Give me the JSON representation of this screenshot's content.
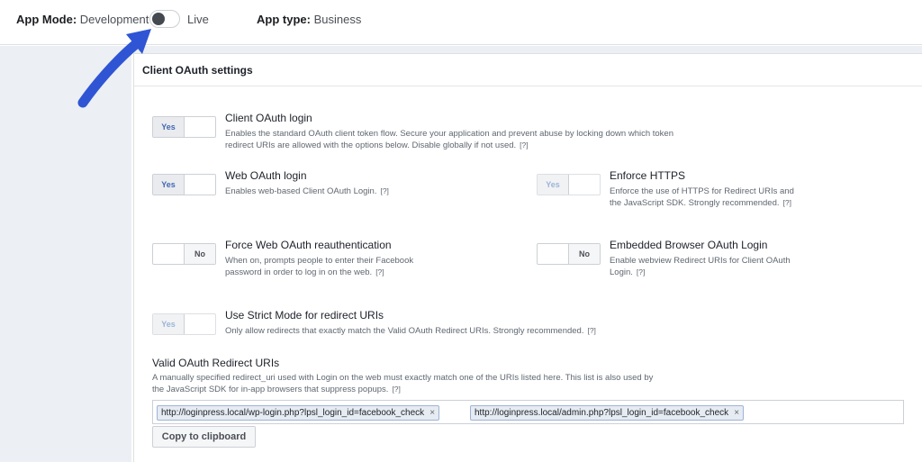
{
  "topbar": {
    "app_mode_label": "App Mode:",
    "app_mode_value": "Development",
    "live_label": "Live",
    "app_type_label": "App type:",
    "app_type_value": "Business"
  },
  "section": {
    "title": "Client OAuth settings"
  },
  "options": [
    {
      "title": "Client OAuth login",
      "desc": "Enables the standard OAuth client token flow. Secure your application and prevent abuse by locking down which token redirect URIs are allowed with the options below. Disable globally if not used.",
      "help": "[?]",
      "state": "Yes"
    },
    {
      "title": "Web OAuth login",
      "desc": "Enables web-based Client OAuth Login.",
      "help": "[?]",
      "state": "Yes"
    },
    {
      "title": "Enforce HTTPS",
      "desc": "Enforce the use of HTTPS for Redirect URIs and the JavaScript SDK. Strongly recommended.",
      "help": "[?]",
      "state": "Yes"
    },
    {
      "title": "Force Web OAuth reauthentication",
      "desc": "When on, prompts people to enter their Facebook password in order to log in on the web.",
      "help": "[?]",
      "state": "No"
    },
    {
      "title": "Embedded Browser OAuth Login",
      "desc": "Enable webview Redirect URIs for Client OAuth Login.",
      "help": "[?]",
      "state": "No"
    },
    {
      "title": "Use Strict Mode for redirect URIs",
      "desc": "Only allow redirects that exactly match the Valid OAuth Redirect URIs. Strongly recommended.",
      "help": "[?]",
      "state": "Yes"
    }
  ],
  "switch_labels": {
    "yes": "Yes",
    "no": "No"
  },
  "redirect": {
    "label": "Valid OAuth Redirect URIs",
    "desc": "A manually specified redirect_uri used with Login on the web must exactly match one of the URIs listed here. This list is also used by the JavaScript SDK for in-app browsers that suppress popups.",
    "help": "[?]",
    "uris": [
      "http://loginpress.local/wp-login.php?lpsl_login_id=facebook_check",
      "http://loginpress.local/admin.php?lpsl_login_id=facebook_check"
    ],
    "remove_glyph": "×",
    "copy_label": "Copy to clipboard"
  },
  "colors": {
    "accent": "#4267b2",
    "arrow": "#2f55d4"
  }
}
